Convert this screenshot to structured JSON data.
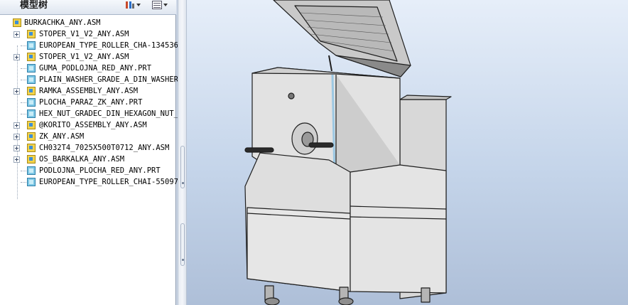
{
  "panel": {
    "title": "模型树"
  },
  "colors": {
    "panel_bg": "#ffffff",
    "viewport_top": "#e6eef9",
    "viewport_bottom": "#aebfd8",
    "model_fill": "#dcdcdc",
    "model_edge": "#1e1e1e"
  },
  "toolbar": {
    "items": [
      {
        "icon": "tree-settings-icon"
      },
      {
        "icon": "show-columns-icon"
      }
    ]
  },
  "tree": {
    "root": {
      "label": "BURKACHKA_ANY.ASM",
      "type": "asm"
    },
    "items": [
      {
        "label": "STOPER_V1_V2_ANY.ASM",
        "type": "asm",
        "expandable": true
      },
      {
        "label": "EUROPEAN_TYPE_ROLLER_CHA-134536.",
        "type": "prt",
        "expandable": false
      },
      {
        "label": "STOPER_V1_V2_ANY.ASM",
        "type": "asm",
        "expandable": true
      },
      {
        "label": "GUMA_PODLOJNA_RED_ANY.PRT",
        "type": "prt",
        "expandable": false
      },
      {
        "label": "PLAIN_WASHER_GRADE_A_DIN_WASHER.",
        "type": "prt",
        "expandable": false
      },
      {
        "label": "RAMKA_ASSEMBLY_ANY.ASM",
        "type": "asm",
        "expandable": true
      },
      {
        "label": "PLOCHA_PARAZ_ZK_ANY.PRT",
        "type": "prt",
        "expandable": false
      },
      {
        "label": "HEX_NUT_GRADEC_DIN_HEXAGON_NUT_.",
        "type": "prt",
        "expandable": false
      },
      {
        "label": "@KORITO_ASSEMBLY_ANY.ASM",
        "type": "asm",
        "expandable": true
      },
      {
        "label": "ZK_ANY.ASM",
        "type": "asm",
        "expandable": true
      },
      {
        "label": "CH032T4_7025X500T0712_ANY.ASM",
        "type": "asm",
        "expandable": true
      },
      {
        "label": "OS_BARKALKA_ANY.ASM",
        "type": "asm",
        "expandable": true
      },
      {
        "label": "PODLOJNA_PLOCHA_RED_ANY.PRT",
        "type": "prt",
        "expandable": false
      },
      {
        "label": "EUROPEAN_TYPE_ROLLER_CHAI-55097.",
        "type": "prt",
        "expandable": false
      }
    ]
  }
}
